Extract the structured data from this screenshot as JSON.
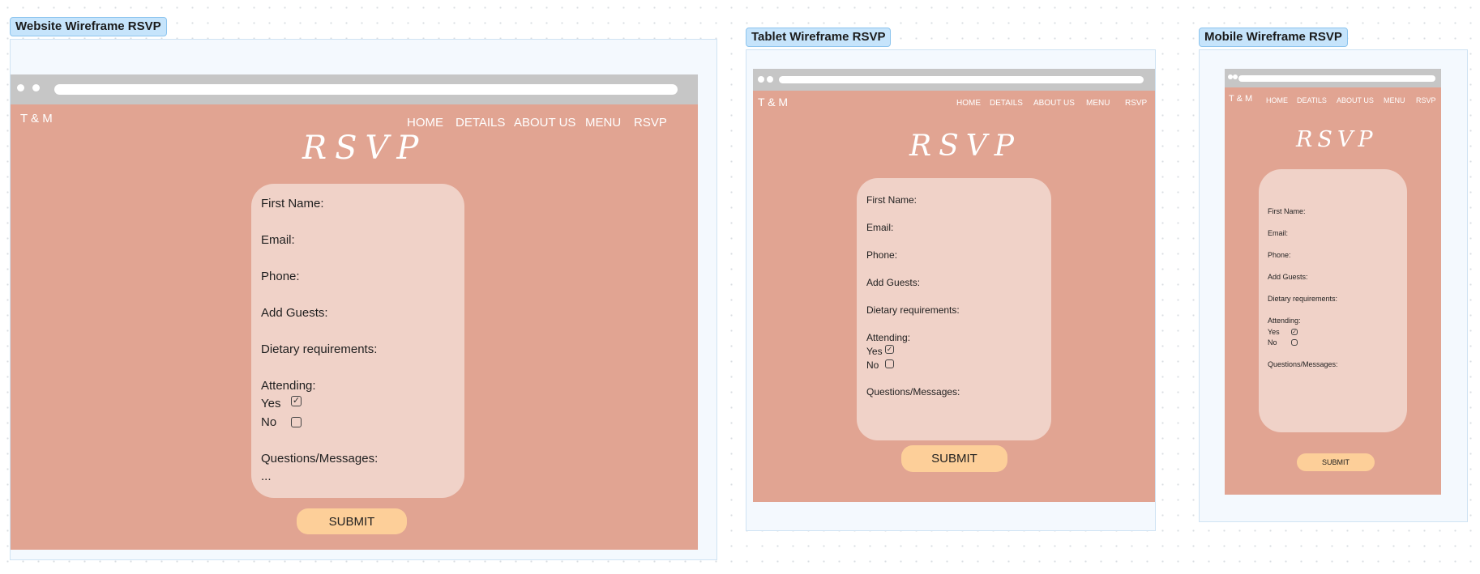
{
  "colors": {
    "canvas": "#ffffff",
    "frame_bg": "#f4f9fe",
    "label_bg": "#c6e4fb",
    "browser_chrome": "#c6c6c6",
    "page_bg": "#e1a492",
    "card_bg": "#f0d2c8",
    "submit_bg": "#fdcf99"
  },
  "website": {
    "frame_label": "Website Wireframe RSVP",
    "brand": "T & M",
    "nav": [
      "HOME",
      "DETAILS",
      "ABOUT US",
      "MENU",
      "RSVP"
    ],
    "title": "RSVP",
    "fields": [
      "First Name:",
      "Email:",
      "Phone:",
      "Add Guests:",
      "Dietary requirements:",
      "Attending:"
    ],
    "options": [
      {
        "label": "Yes",
        "checked": true
      },
      {
        "label": "No",
        "checked": false
      }
    ],
    "messages_label": "Questions/Messages:",
    "messages_value": "...",
    "submit": "SUBMIT"
  },
  "tablet": {
    "frame_label": "Tablet Wireframe RSVP",
    "brand": "T & M",
    "nav": [
      "HOME",
      "DETAILS",
      "ABOUT US",
      "MENU",
      "RSVP"
    ],
    "title": "RSVP",
    "fields": [
      "First Name:",
      "Email:",
      "Phone:",
      "Add Guests:",
      "Dietary requirements:",
      "Attending:"
    ],
    "options": [
      {
        "label": "Yes",
        "checked": true
      },
      {
        "label": "No",
        "checked": false
      }
    ],
    "messages_label": "Questions/Messages:",
    "submit": "SUBMIT"
  },
  "mobile": {
    "frame_label": "Mobile Wireframe RSVP",
    "brand": "T & M",
    "nav": [
      "HOME",
      "DEATILS",
      "ABOUT US",
      "MENU",
      "RSVP"
    ],
    "title": "RSVP",
    "fields": [
      "First Name:",
      "Email:",
      "Phone:",
      "Add Guests:",
      "Dietary requirements:",
      "Attending:"
    ],
    "options": [
      {
        "label": "Yes",
        "checked": true
      },
      {
        "label": "No",
        "checked": false
      }
    ],
    "messages_label": "Questions/Messages:",
    "submit": "SUBMIT"
  }
}
